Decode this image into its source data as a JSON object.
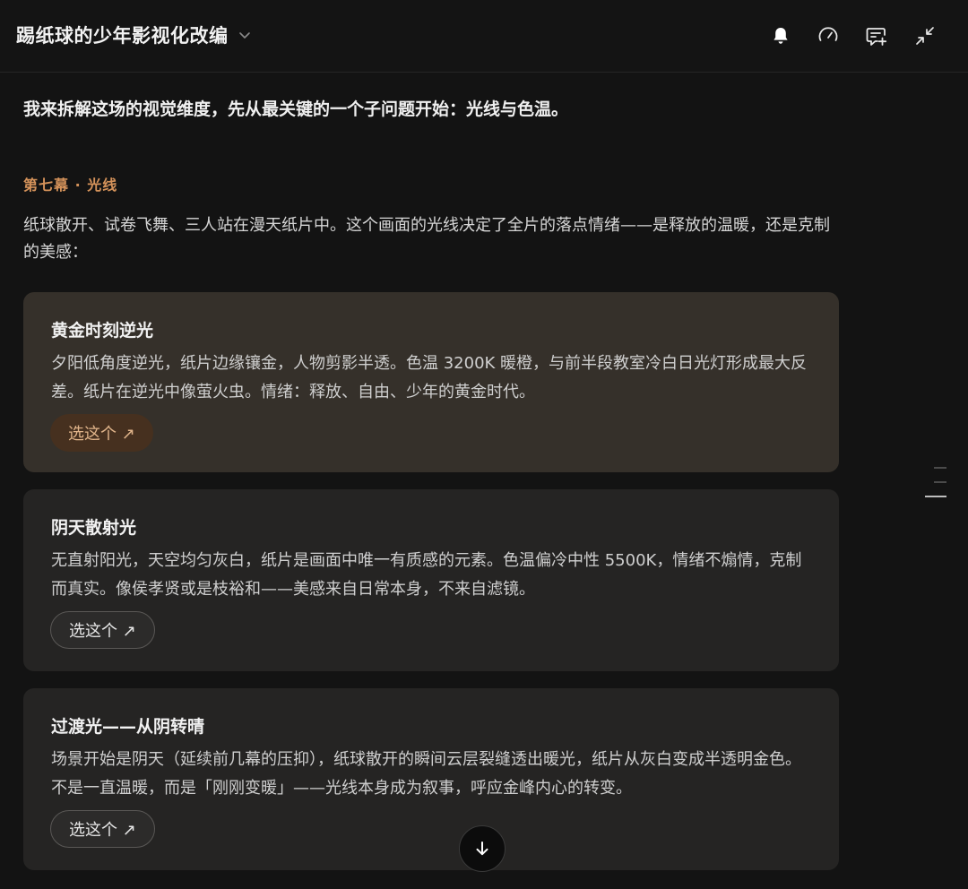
{
  "header": {
    "title": "踢纸球的少年影视化改编",
    "icons": [
      "chevron-down-icon",
      "bell-icon",
      "speedometer-icon",
      "comment-add-icon",
      "collapse-icon"
    ]
  },
  "main": {
    "intro": "我来拆解这场的视觉维度，先从最关键的一个子问题开始：光线与色温。",
    "section_label": "第七幕 · 光线",
    "paragraph": "纸球散开、试卷飞舞、三人站在漫天纸片中。这个画面的光线决定了全片的落点情绪——是释放的温暖，还是克制的美感：",
    "options": [
      {
        "title": "黄金时刻逆光",
        "description": "夕阳低角度逆光，纸片边缘镶金，人物剪影半透。色温 3200K 暖橙，与前半段教室冷白日光灯形成最大反差。纸片在逆光中像萤火虫。情绪：释放、自由、少年的黄金时代。",
        "button": "选这个 ↗",
        "selected": true
      },
      {
        "title": "阴天散射光",
        "description": "无直射阳光，天空均匀灰白，纸片是画面中唯一有质感的元素。色温偏冷中性 5500K，情绪不煽情，克制而真实。像侯孝贤或是枝裕和——美感来自日常本身，不来自滤镜。",
        "button": "选这个 ↗",
        "selected": false
      },
      {
        "title": "过渡光——从阴转晴",
        "description": "场景开始是阴天（延续前几幕的压抑），纸球散开的瞬间云层裂缝透出暖光，纸片从灰白变成半透明金色。不是一直温暖，而是「刚刚变暖」——光线本身成为叙事，呼应金峰内心的转变。",
        "button": "选这个 ↗",
        "selected": false
      }
    ]
  },
  "colors": {
    "accent": "#d4925a",
    "background": "#131313",
    "card": "#252423",
    "card_selected": "#35302a"
  }
}
